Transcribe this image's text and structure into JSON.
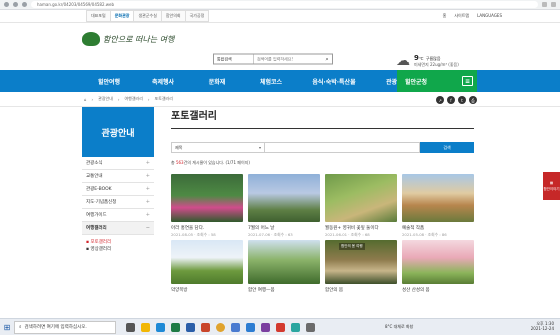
{
  "browser": {
    "url": "haman.go.kr/04203/04569/04582.web"
  },
  "util": {
    "tabs": [
      "대표포털",
      "문화관광",
      "생관군수실",
      "함안의회",
      "국가공정"
    ],
    "active_tab": 1,
    "right": [
      "홈",
      "사이트맵",
      "LANGUAGES"
    ]
  },
  "header": {
    "logo_text": "함안으로 떠나는 여행",
    "search_select": "통합검색",
    "search_placeholder": "검색어를 입력하세요!",
    "weather_temp": "9",
    "weather_unit": "℃",
    "weather_cond": "구름많음",
    "weather_dust": "미세먼지 22ug/m³ (좋음)"
  },
  "gnb": {
    "items": [
      "힐안여행",
      "축제행사",
      "문화재",
      "체험코스",
      "음식·숙박·특산물",
      "관광안내"
    ],
    "tour_label": "힐안군청",
    "menu_icon": "≡"
  },
  "location": {
    "home_icon": "⌂",
    "crumbs": [
      "관광안내",
      "여행갤러리",
      "포토갤러리"
    ],
    "separator": "›",
    "share_icons": [
      "share-icon",
      "facebook-icon",
      "twitter-icon",
      "print-icon"
    ],
    "share_glyphs": [
      "↗",
      "f",
      "t",
      "⎙"
    ]
  },
  "sidebar": {
    "title": "관광안내",
    "items": [
      "관광소식",
      "교통안내",
      "관광E-BOOK",
      "지도·기념품신청",
      "여행가이드",
      "여행갤러리"
    ],
    "active": 5,
    "sub": [
      "포토갤러리",
      "영상갤러리"
    ],
    "sub_active": 0,
    "sub_bullet": "▪"
  },
  "content": {
    "title": "포토갤러리",
    "search_select": "제목",
    "search_button": "검색",
    "count_prefix": "총 ",
    "count_num": "563",
    "count_suffix": "건의 게시물이 있습니다. (1/71 페이지)",
    "cards": [
      {
        "title": "아라 홍연을 담다.",
        "meta": "2021-08-05 · 조회수 : 58"
      },
      {
        "title": "7월의 어느 날",
        "meta": "2021-07-06 · 조회수 : 63"
      },
      {
        "title": "월동원+ 영귀비 꽃잎 둘이다",
        "meta": "2021-06-01 · 조회수 : 68"
      },
      {
        "title": "예술적 작품",
        "meta": "2021-05-08 · 조회수 : 86"
      },
      {
        "title": "악양목방",
        "meta": ""
      },
      {
        "title": "함안 여행—봄",
        "meta": ""
      },
      {
        "title": "함안의 봄",
        "meta": ""
      },
      {
        "title": "성산 산성의 봄",
        "meta": ""
      }
    ],
    "img_caption_6": "함안의 봄 여행"
  },
  "float_badge": {
    "label": "함안이야기"
  },
  "taskbar": {
    "start_icon": "⊞",
    "search_placeholder": "검색하려면 여기에 입력하십시오.",
    "weather": "8°C 대체로 화창",
    "time": "오후 1:30",
    "date": "2021-12-24"
  },
  "colors": {
    "primary": "#0b7ec9",
    "green": "#10a74b",
    "accent_red": "#d2232a"
  }
}
